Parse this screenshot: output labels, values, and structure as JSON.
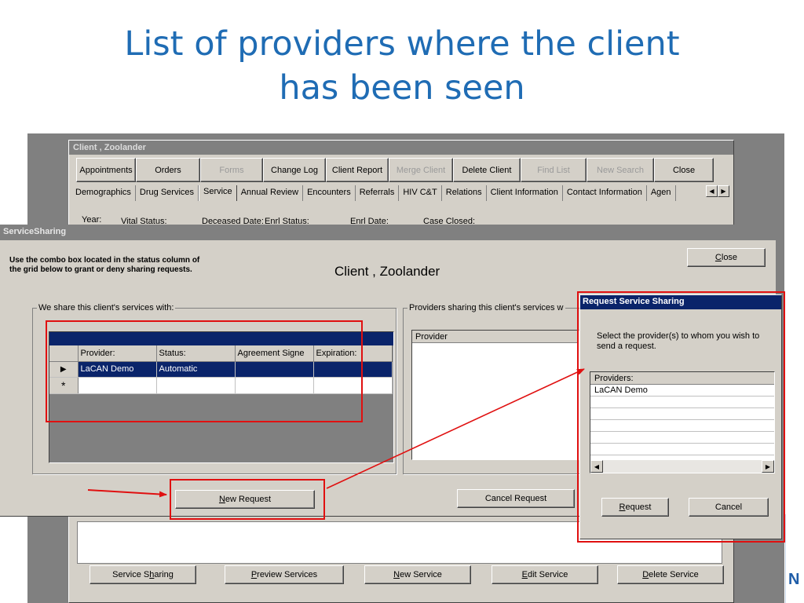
{
  "slide": {
    "title_line1": "List of providers where the client",
    "title_line2": "has been seen"
  },
  "client_window": {
    "title": "Client , Zoolander",
    "toolbar": [
      {
        "label": "Appointments",
        "enabled": true
      },
      {
        "label": "Orders",
        "enabled": true
      },
      {
        "label": "Forms",
        "enabled": false
      },
      {
        "label": "Change Log",
        "enabled": true
      },
      {
        "label": "Client Report",
        "enabled": true
      },
      {
        "label": "Merge Client",
        "enabled": false
      },
      {
        "label": "Delete Client",
        "enabled": true
      },
      {
        "label": "Find List",
        "enabled": false
      },
      {
        "label": "New Search",
        "enabled": false
      },
      {
        "label": "Close",
        "enabled": true
      }
    ],
    "tabs": [
      "Demographics",
      "Drug Services",
      "Service",
      "Annual Review",
      "Encounters",
      "Referrals",
      "HIV C&T",
      "Relations",
      "Client Information",
      "Contact Information",
      "Agen"
    ],
    "active_tab": "Service",
    "status_labels": [
      "Year:",
      "Vital Status:",
      "Deceased Date:",
      "Enrl Status:",
      "Enrl Date:",
      "Case Closed:"
    ],
    "bottom_buttons": {
      "service_sharing": {
        "pre": "Service S",
        "key": "h",
        "post": "aring"
      },
      "preview_services": {
        "pre": "",
        "key": "P",
        "post": "review Services"
      },
      "new_service": {
        "pre": "",
        "key": "N",
        "post": "ew Service"
      },
      "edit_service": {
        "pre": "",
        "key": "E",
        "post": "dit Service"
      },
      "delete_service": {
        "pre": "",
        "key": "D",
        "post": "elete Service"
      }
    }
  },
  "service_sharing": {
    "title": "ServiceSharing",
    "instruction_line1": "Use the combo box located in the status column of",
    "instruction_line2": "the grid below to grant or deny sharing requests.",
    "client_name": "Client , Zoolander",
    "close_button": {
      "key": "C",
      "post": "lose"
    },
    "share_group_label": "We share this client's services with:",
    "grid": {
      "columns": [
        "Provider:",
        "Status:",
        "Agreement Signe",
        "Expiration:"
      ],
      "rows": [
        {
          "indicator": "▶",
          "provider": "LaCAN Demo",
          "status": "Automatic",
          "agreement": "",
          "expiration": ""
        }
      ],
      "new_row_indicator": "*"
    },
    "providers_group_label": "Providers sharing this client's services w",
    "providers_list_header": "Provider",
    "new_request_button": {
      "key": "N",
      "post": "ew Request"
    },
    "cancel_request_button": "Cancel Request"
  },
  "request_dialog": {
    "title": "Request Service Sharing",
    "text": "Select the provider(s) to whom you wish to send a request.",
    "list_header": "Providers:",
    "providers": [
      "LaCAN Demo"
    ],
    "request_button": {
      "key": "R",
      "post": "equest"
    },
    "cancel_button": "Cancel"
  },
  "annotation_color": "#e01010",
  "edge_fragment": "N"
}
